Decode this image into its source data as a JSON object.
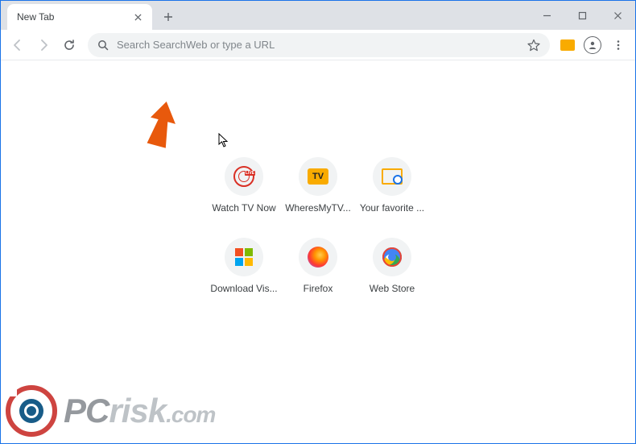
{
  "tab": {
    "title": "New Tab"
  },
  "omnibox": {
    "placeholder": "Search SearchWeb or type a URL"
  },
  "shortcuts": [
    {
      "label": "Watch TV Now",
      "icon": "globe-live"
    },
    {
      "label": "WheresMyTV...",
      "icon": "tv-badge"
    },
    {
      "label": "Your favorite ...",
      "icon": "fav-tile"
    },
    {
      "label": "Download Vis...",
      "icon": "ms-tile"
    },
    {
      "label": "Firefox",
      "icon": "ff-tile"
    },
    {
      "label": "Web Store",
      "icon": "ws-tile"
    }
  ],
  "watermark": {
    "pc": "PC",
    "risk": "risk",
    "com": ".com"
  },
  "tv_badge_text": "TV"
}
